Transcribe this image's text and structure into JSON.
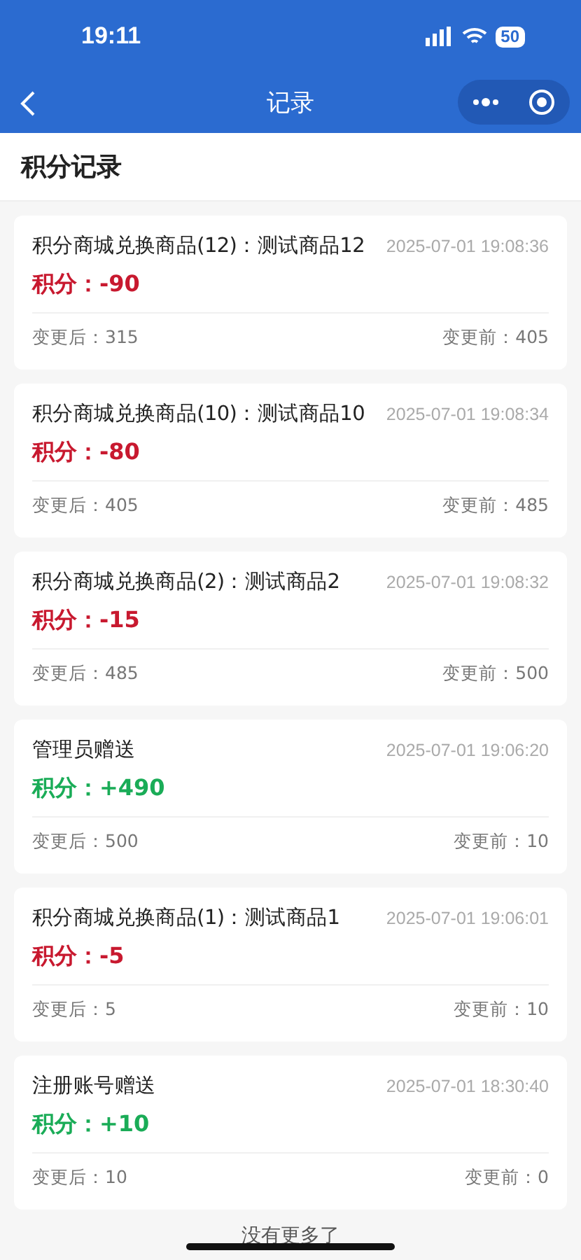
{
  "status_bar": {
    "time": "19:11",
    "battery": "50"
  },
  "nav": {
    "title": "记录"
  },
  "header": {
    "title": "积分记录"
  },
  "records": [
    {
      "title": "积分商城兑换商品(12)：测试商品12",
      "time": "2025-07-01 19:08:36",
      "points": "积分：-90",
      "kind": "deduct",
      "after": "变更后：315",
      "before": "变更前：405"
    },
    {
      "title": "积分商城兑换商品(10)：测试商品10",
      "time": "2025-07-01 19:08:34",
      "points": "积分：-80",
      "kind": "deduct",
      "after": "变更后：405",
      "before": "变更前：485"
    },
    {
      "title": "积分商城兑换商品(2)：测试商品2",
      "time": "2025-07-01 19:08:32",
      "points": "积分：-15",
      "kind": "deduct",
      "after": "变更后：485",
      "before": "变更前：500"
    },
    {
      "title": "管理员赠送",
      "time": "2025-07-01 19:06:20",
      "points": "积分：+490",
      "kind": "add",
      "after": "变更后：500",
      "before": "变更前：10"
    },
    {
      "title": "积分商城兑换商品(1)：测试商品1",
      "time": "2025-07-01 19:06:01",
      "points": "积分：-5",
      "kind": "deduct",
      "after": "变更后：5",
      "before": "变更前：10"
    },
    {
      "title": "注册账号赠送",
      "time": "2025-07-01 18:30:40",
      "points": "积分：+10",
      "kind": "add",
      "after": "变更后：10",
      "before": "变更前：0"
    }
  ],
  "footer": {
    "text": "没有更多了"
  }
}
